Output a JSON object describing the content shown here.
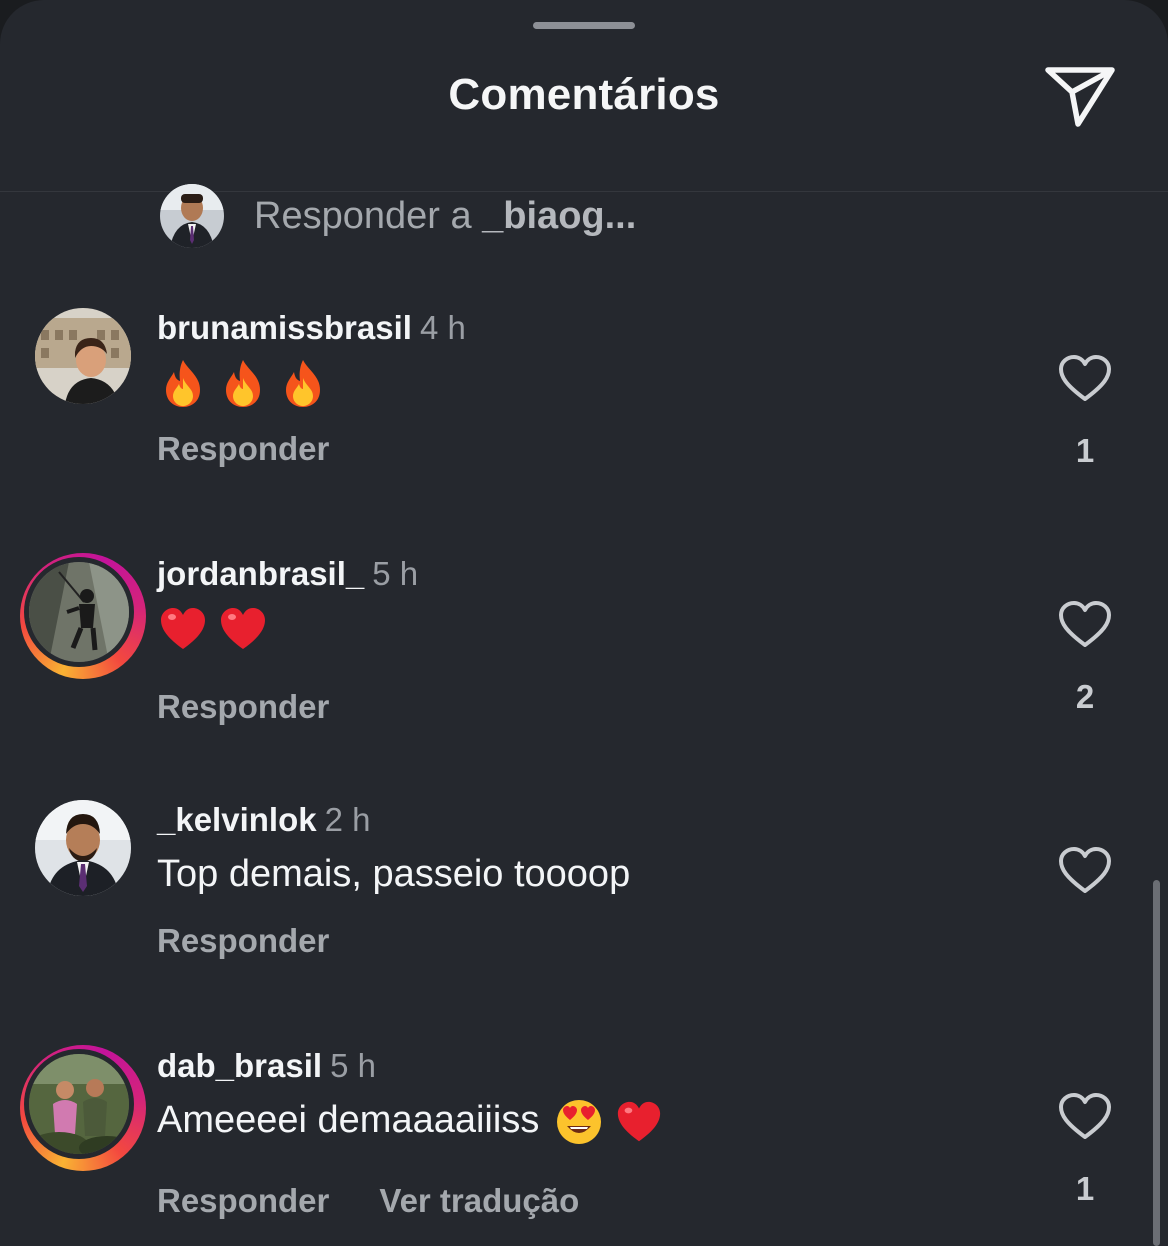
{
  "header": {
    "title": "Comentários",
    "share_icon": "paper-plane-icon"
  },
  "reply_bar": {
    "prefix": "Responder a ",
    "username": "_biaog..."
  },
  "comments": [
    {
      "username": "brunamissbrasil",
      "time": "4 h",
      "text": "",
      "emojis": [
        "fire",
        "fire",
        "fire"
      ],
      "reply_label": "Responder",
      "translate_label": "",
      "likes": "1",
      "story_ring": false
    },
    {
      "username": "jordanbrasil_",
      "time": "5 h",
      "text": "",
      "emojis": [
        "red-heart",
        "red-heart"
      ],
      "reply_label": "Responder",
      "translate_label": "",
      "likes": "2",
      "story_ring": true
    },
    {
      "username": "_kelvinlok",
      "time": "2 h",
      "text": "Top demais, passeio toooop",
      "emojis": [],
      "reply_label": "Responder",
      "translate_label": "",
      "likes": "",
      "story_ring": false
    },
    {
      "username": "dab_brasil",
      "time": "5 h",
      "text": "Ameeeei demaaaaiiiss",
      "emojis": [
        "heart-eyes",
        "red-heart"
      ],
      "reply_label": "Responder",
      "translate_label": "Ver tradução",
      "likes": "1",
      "story_ring": true
    }
  ],
  "colors": {
    "background": "#25282e",
    "text": "#f3f5f7",
    "muted": "#a4a8ad"
  }
}
